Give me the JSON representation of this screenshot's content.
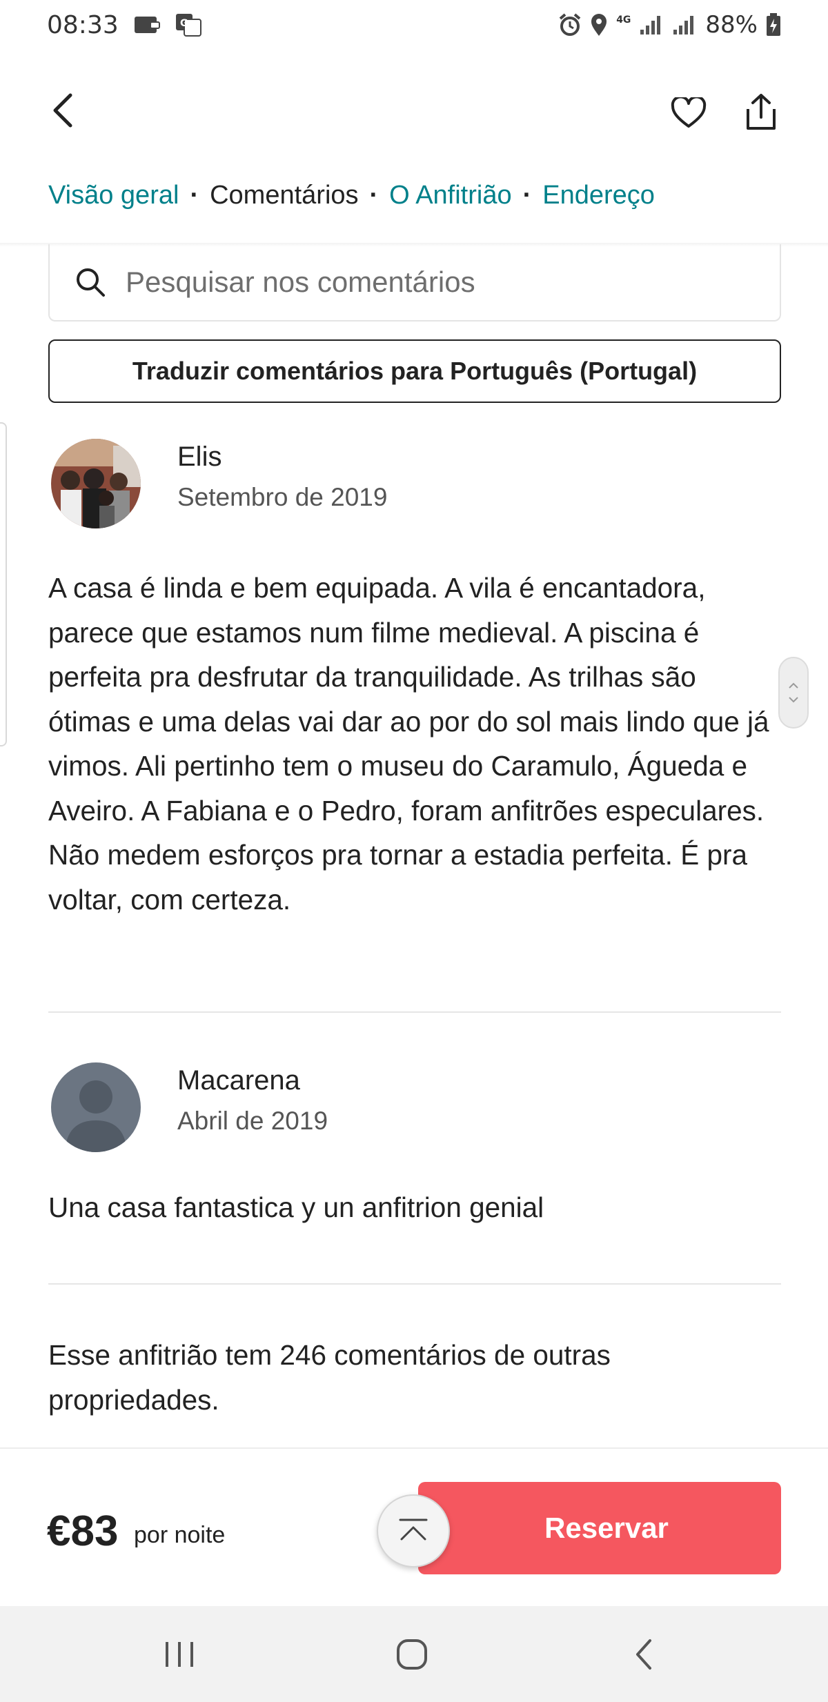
{
  "status_bar": {
    "time": "08:33",
    "network": "4G",
    "battery": "88%"
  },
  "nav": {
    "tabs": [
      {
        "label": "Visão geral"
      },
      {
        "label": "Comentários"
      },
      {
        "label": "O Anfitrião"
      },
      {
        "label": "Endereço"
      }
    ],
    "active_tab": "Comentários"
  },
  "search": {
    "placeholder": "Pesquisar nos comentários"
  },
  "translate_button": "Traduzir comentários para Português (Portugal)",
  "reviews": [
    {
      "name": "Elis",
      "date": "Setembro de 2019",
      "text": "A casa é linda e bem equipada. A vila é encantadora, parece que estamos num filme medieval. A piscina é perfeita pra desfrutar da tranquilidade. As trilhas são ótimas e uma delas vai dar ao por do sol mais lindo que já vimos. Ali pertinho tem o museu do Caramulo, Águeda e Aveiro. A Fabiana e o Pedro, foram anfitrões especulares. Não medem esforços pra tornar a estadia perfeita. É pra voltar, com certeza."
    },
    {
      "name": "Macarena",
      "date": "Abril de 2019",
      "text": "Una casa fantastica y un anfitrion genial"
    }
  ],
  "other_reviews_note": "Esse anfitrião tem 246 comentários de outras propriedades.",
  "booking": {
    "price": "€83",
    "price_unit": "por noite",
    "reserve_label": "Reservar"
  },
  "colors": {
    "link_teal": "#00808a",
    "reserve_red": "#f5575f",
    "text": "#222222"
  },
  "icons": [
    "back-arrow-icon",
    "heart-icon",
    "share-icon",
    "search-icon",
    "scroll-top-icon",
    "recents-icon",
    "home-icon",
    "back-icon"
  ]
}
